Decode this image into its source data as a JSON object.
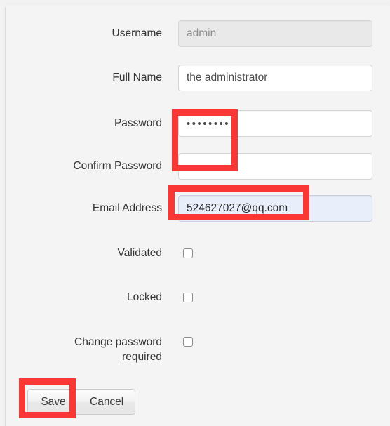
{
  "form": {
    "fields": [
      {
        "label": "Username",
        "type": "text",
        "value": "admin",
        "state": "disabled"
      },
      {
        "label": "Full Name",
        "type": "text",
        "value": "the administrator",
        "state": "normal"
      },
      {
        "label": "Password",
        "type": "password",
        "value": "••••••••",
        "state": "normal"
      },
      {
        "label": "Confirm Password",
        "type": "password",
        "value": "••••••••",
        "state": "normal"
      },
      {
        "label": "Email Address",
        "type": "email",
        "value": "524627027@qq.com",
        "state": "autofilled"
      },
      {
        "label": "Validated",
        "type": "checkbox",
        "checked": false
      },
      {
        "label": "Locked",
        "type": "checkbox",
        "checked": false
      },
      {
        "label": "Change password required",
        "label_line_1": "Change password",
        "label_line_2": "required",
        "type": "checkbox",
        "checked": false
      }
    ]
  },
  "buttons": {
    "save_label": "Save",
    "cancel_label": "Cancel"
  },
  "annotations": {
    "color": "#f93734",
    "items": [
      {
        "target": "password-fields"
      },
      {
        "target": "email-address-field"
      },
      {
        "target": "save-button"
      }
    ]
  }
}
